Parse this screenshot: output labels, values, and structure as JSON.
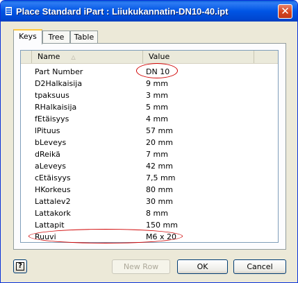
{
  "window": {
    "title": "Place Standard iPart : Liiukukannatin-DN10-40.ipt",
    "close_glyph": "✕"
  },
  "tabs": [
    {
      "label": "Keys",
      "active": true
    },
    {
      "label": "Tree",
      "active": false
    },
    {
      "label": "Table",
      "active": false
    }
  ],
  "grid": {
    "columns": {
      "name": "Name",
      "value": "Value"
    },
    "rows": [
      {
        "name": "Part Number",
        "value": "DN 10"
      },
      {
        "name": "D2Halkaisija",
        "value": "9 mm"
      },
      {
        "name": "tpaksuus",
        "value": "3 mm"
      },
      {
        "name": "RHalkaisija",
        "value": "5 mm"
      },
      {
        "name": "fEtäisyys",
        "value": "4 mm"
      },
      {
        "name": "lPituus",
        "value": "57 mm"
      },
      {
        "name": "bLeveys",
        "value": "20 mm"
      },
      {
        "name": "dReikä",
        "value": "7 mm"
      },
      {
        "name": "aLeveys",
        "value": "42 mm"
      },
      {
        "name": "cEtäisyys",
        "value": "7,5 mm"
      },
      {
        "name": "HKorkeus",
        "value": "80 mm"
      },
      {
        "name": "Lattalev2",
        "value": "30 mm"
      },
      {
        "name": "Lattakork",
        "value": "8 mm"
      },
      {
        "name": "Lattapit",
        "value": "150 mm"
      },
      {
        "name": "Ruuvi",
        "value": "M6 x 20"
      }
    ]
  },
  "buttons": {
    "help": "?",
    "new_row": "New Row",
    "ok": "OK",
    "cancel": "Cancel"
  },
  "colors": {
    "titlebar": "#0055e5",
    "annotation": "#d00000"
  }
}
